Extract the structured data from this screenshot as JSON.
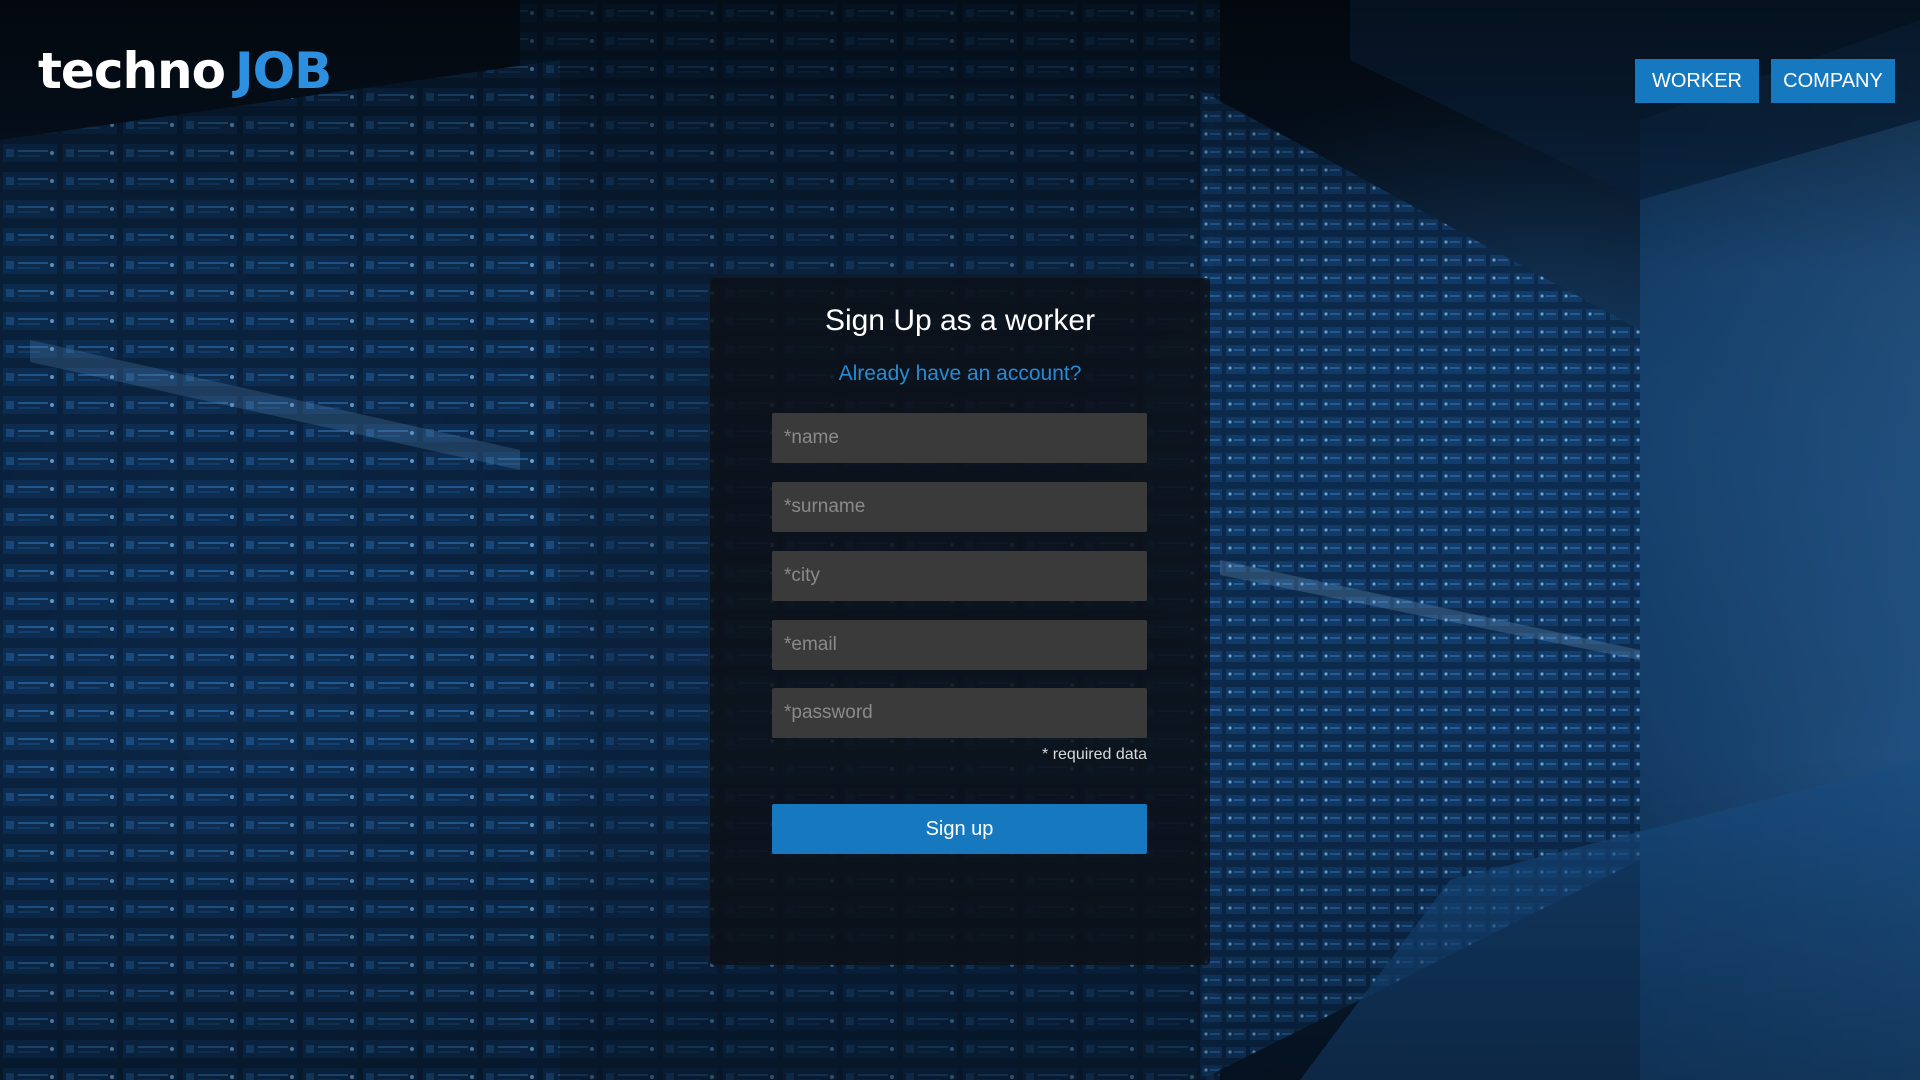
{
  "header": {
    "logo_techno": "techno",
    "logo_job": "JOB",
    "nav": {
      "worker_label": "WORKER",
      "company_label": "COMPANY"
    }
  },
  "form": {
    "title": "Sign Up as a worker",
    "login_link": "Already have an account?",
    "fields": {
      "name_placeholder": "*name",
      "surname_placeholder": "*surname",
      "city_placeholder": "*city",
      "email_placeholder": "*email",
      "password_placeholder": "*password"
    },
    "required_note": "* required data",
    "submit_label": "Sign up"
  },
  "colors": {
    "accent": "#1679c0",
    "link": "#2a8ad4",
    "logo_job": "#2c8fe0",
    "card_bg": "#0c1016",
    "input_bg": "#3a3a3a"
  }
}
